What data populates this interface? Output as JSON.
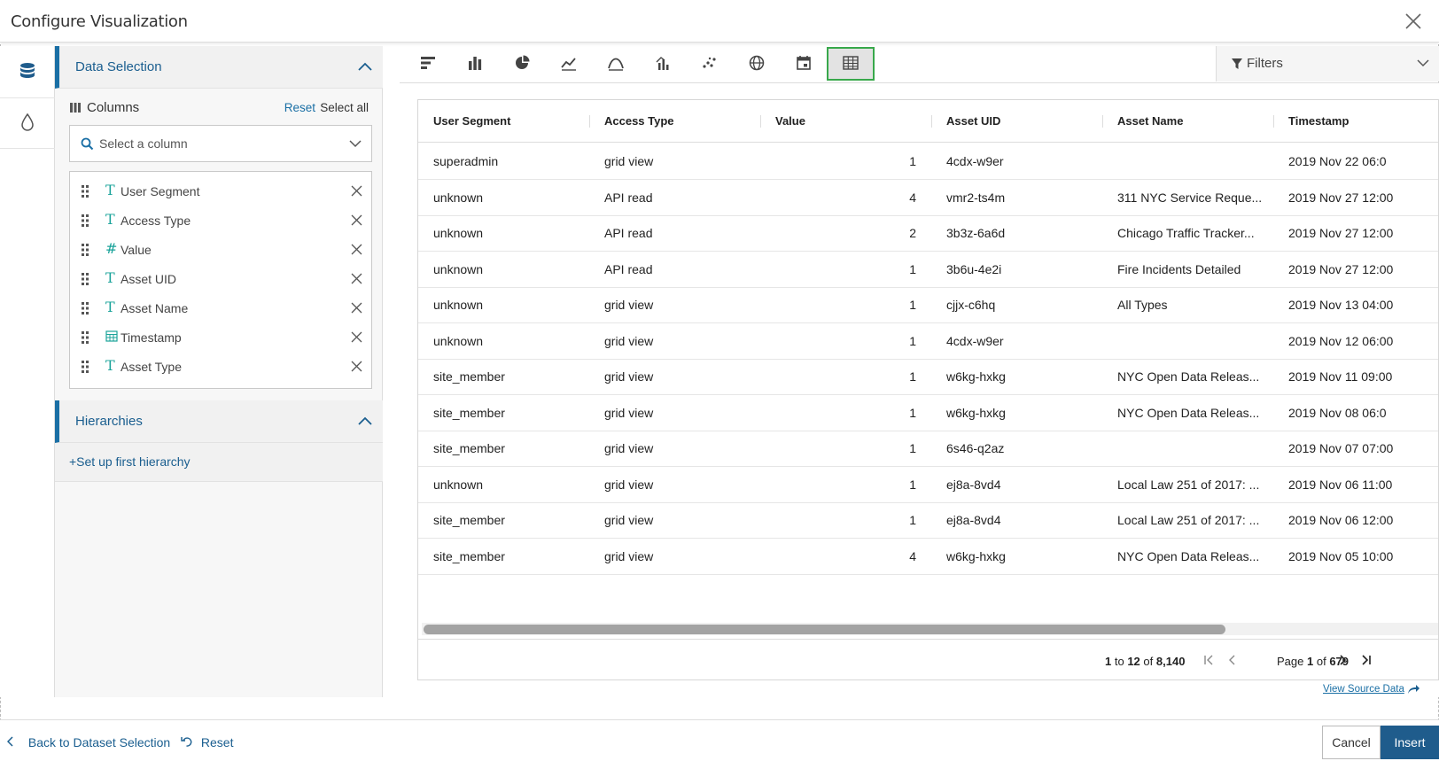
{
  "header": {
    "title": "Configure Visualization",
    "close_icon": "close-icon"
  },
  "rail": {
    "items": [
      {
        "icon": "database-icon"
      },
      {
        "icon": "droplet-icon"
      }
    ]
  },
  "data_selection": {
    "title": "Data Selection",
    "columns_label": "Columns",
    "reset_label": "Reset",
    "select_all_label": "Select all",
    "search_placeholder": "Select a column",
    "columns": [
      {
        "name": "User Segment",
        "type": "text"
      },
      {
        "name": "Access Type",
        "type": "text"
      },
      {
        "name": "Value",
        "type": "number"
      },
      {
        "name": "Asset UID",
        "type": "text"
      },
      {
        "name": "Asset Name",
        "type": "text"
      },
      {
        "name": "Timestamp",
        "type": "date"
      },
      {
        "name": "Asset Type",
        "type": "text"
      }
    ]
  },
  "hierarchies": {
    "title": "Hierarchies",
    "setup_link": "+Set up first hierarchy"
  },
  "toolbar": {
    "viz_types": [
      "horizontal-bar-icon",
      "bar-chart-icon",
      "pie-chart-icon",
      "line-chart-icon",
      "area-chart-icon",
      "combo-chart-icon",
      "scatter-plot-icon",
      "globe-map-icon",
      "calendar-icon",
      "table-icon"
    ],
    "active_viz": "table-icon",
    "filters_label": "Filters"
  },
  "table": {
    "headers": [
      "User Segment",
      "Access Type",
      "Value",
      "Asset UID",
      "Asset Name",
      "Timestamp"
    ],
    "rows": [
      [
        "superadmin",
        "grid view",
        "1",
        "4cdx-w9er",
        "",
        "2019 Nov 22 06:0"
      ],
      [
        "unknown",
        "API read",
        "4",
        "vmr2-ts4m",
        "311 NYC Service Reque...",
        "2019 Nov 27 12:00"
      ],
      [
        "unknown",
        "API read",
        "2",
        "3b3z-6a6d",
        "Chicago Traffic Tracker...",
        "2019 Nov 27 12:00"
      ],
      [
        "unknown",
        "API read",
        "1",
        "3b6u-4e2i",
        "Fire Incidents Detailed",
        "2019 Nov 27 12:00"
      ],
      [
        "unknown",
        "grid view",
        "1",
        "cjjx-c6hq",
        "All Types",
        "2019 Nov 13 04:00"
      ],
      [
        "unknown",
        "grid view",
        "1",
        "4cdx-w9er",
        "",
        "2019 Nov 12 06:00"
      ],
      [
        "site_member",
        "grid view",
        "1",
        "w6kg-hxkg",
        "NYC Open Data Releas...",
        "2019 Nov 11 09:00"
      ],
      [
        "site_member",
        "grid view",
        "1",
        "w6kg-hxkg",
        "NYC Open Data Releas...",
        "2019 Nov 08 06:0"
      ],
      [
        "site_member",
        "grid view",
        "1",
        "6s46-q2az",
        "",
        "2019 Nov 07 07:00"
      ],
      [
        "unknown",
        "grid view",
        "1",
        "ej8a-8vd4",
        "Local Law 251 of 2017: ...",
        "2019 Nov 06 11:00"
      ],
      [
        "site_member",
        "grid view",
        "1",
        "ej8a-8vd4",
        "Local Law 251 of 2017: ...",
        "2019 Nov 06 12:00"
      ],
      [
        "site_member",
        "grid view",
        "4",
        "w6kg-hxkg",
        "NYC Open Data Releas...",
        "2019 Nov 05 10:00"
      ]
    ],
    "pagination": {
      "from": "1",
      "to_word": "to",
      "to": "12",
      "of_word": "of",
      "total": "8,140",
      "page_word": "Page",
      "page": "1",
      "page_of_word": "of",
      "page_total": "679"
    },
    "scroll_fraction": 0.79
  },
  "view_source_label": "View Source Data",
  "footer": {
    "back_label": "Back to Dataset Selection",
    "reset_label": "Reset",
    "cancel_label": "Cancel",
    "insert_label": "Insert"
  },
  "colors": {
    "accent": "#1a6fa5",
    "primary_button": "#1f5c8c",
    "type_icon": "#1aa39a",
    "active_outline": "#38a84b"
  }
}
